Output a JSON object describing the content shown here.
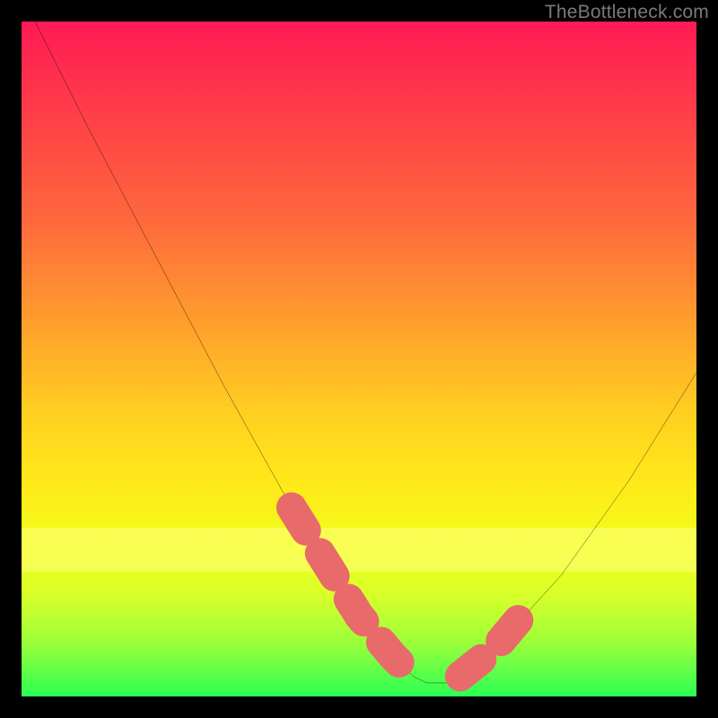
{
  "watermark": "TheBottleneck.com",
  "chart_data": {
    "type": "line",
    "title": "",
    "xlabel": "",
    "ylabel": "",
    "xlim": [
      0,
      100
    ],
    "ylim": [
      0,
      100
    ],
    "series": [
      {
        "name": "bottleneck-curve",
        "x": [
          2,
          10,
          20,
          30,
          40,
          45,
          50,
          55,
          58,
          60,
          63,
          65,
          70,
          80,
          90,
          100
        ],
        "y": [
          100,
          84,
          65,
          46,
          28,
          20,
          12,
          6,
          3,
          2,
          2,
          3,
          7,
          18,
          32,
          48
        ]
      }
    ],
    "highlight_segments": [
      {
        "name": "left-descent-highlight",
        "x": [
          40,
          45,
          50,
          55,
          58
        ],
        "y": [
          28,
          20,
          12,
          6,
          3
        ]
      },
      {
        "name": "right-ascent-highlight",
        "x": [
          65,
          70,
          75
        ],
        "y": [
          3,
          7,
          13
        ]
      }
    ],
    "background_gradient": {
      "top": "#ff1a55",
      "bottom": "#2cff55"
    }
  }
}
